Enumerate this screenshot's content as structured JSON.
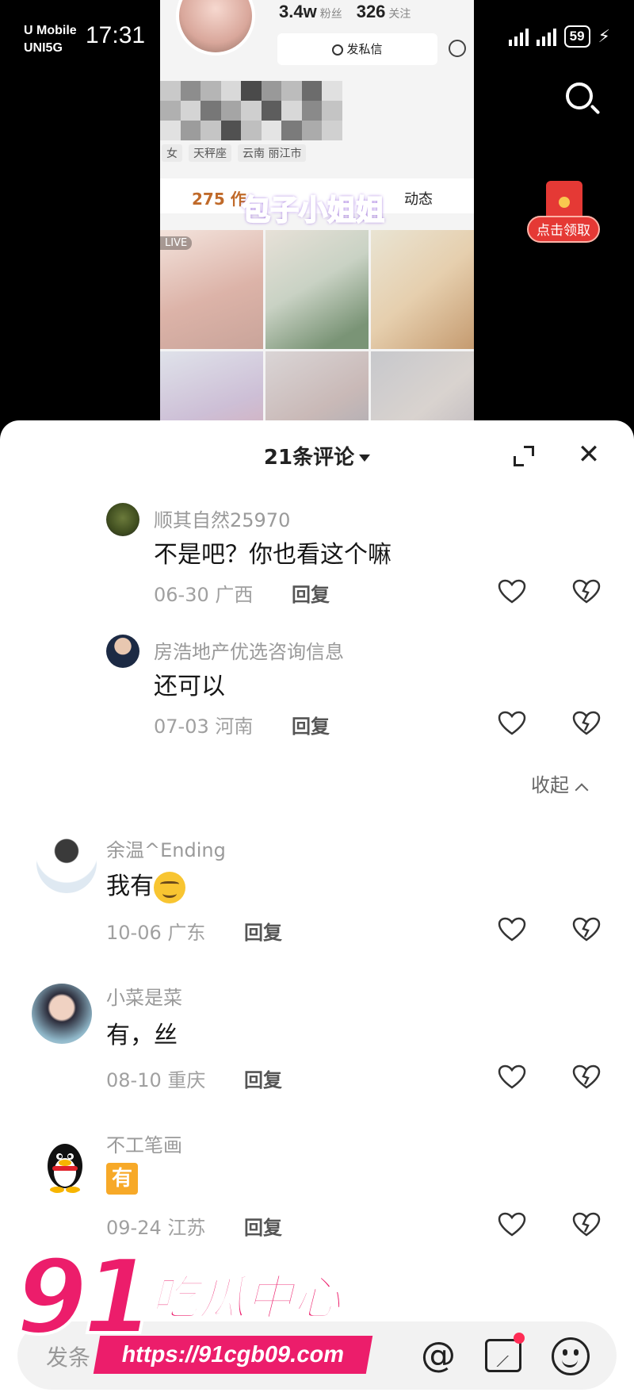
{
  "status_bar": {
    "carrier_line1": "U Mobile",
    "carrier_line2": "UNI5G",
    "time": "17:31",
    "battery": "59"
  },
  "profile_preview": {
    "followers_count": "3.4w",
    "followers_label": "粉丝",
    "following_count": "326",
    "following_label": "关注",
    "message_button": "发私信",
    "tags": [
      "女",
      "天秤座",
      "云南 丽江市"
    ],
    "works_tab": "275 作",
    "dynamics_tab": "动态",
    "live_badge": "LIVE",
    "overlay_name": "包子小姐姐"
  },
  "red_packet": {
    "label": "点击领取"
  },
  "comments_panel": {
    "title": "21条评论",
    "collapse_label": "收起",
    "reply_label": "回复",
    "comments": [
      {
        "user": "顺其自然25970",
        "text": "不是吧？你也看这个嘛",
        "date": "06-30",
        "region": "广西"
      },
      {
        "user": "房浩地产优选咨询信息",
        "text": "还可以",
        "date": "07-03",
        "region": "河南"
      },
      {
        "user": "余温^Ending",
        "text": "我有",
        "date": "10-06",
        "region": "广东"
      },
      {
        "user": "小菜是菜",
        "text": "有，丝",
        "date": "08-10",
        "region": "重庆"
      },
      {
        "user": "不工笔画",
        "text": "有",
        "date": "09-24",
        "region": "江苏"
      }
    ]
  },
  "input_bar": {
    "placeholder": "发条",
    "icons": [
      "at-icon",
      "image-icon",
      "emoji-icon"
    ]
  },
  "watermark": {
    "number": "91",
    "name": "吃瓜中心",
    "url": "https://91cgb09.com"
  },
  "colors": {
    "accent_red": "#e53935",
    "watermark_pink": "#ec1d6b",
    "muted_text": "#9a9a9a"
  }
}
